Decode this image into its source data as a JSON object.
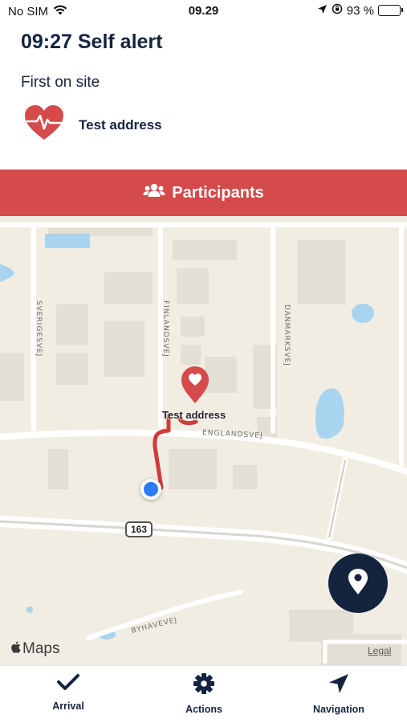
{
  "status_bar": {
    "carrier": "No SIM",
    "time": "09.29",
    "battery": "93 %"
  },
  "alert": {
    "title": "09:27 Self alert",
    "subtitle": "First on site",
    "address": "Test address"
  },
  "participants_button": {
    "label": "Participants"
  },
  "map": {
    "pin_label": "Test address",
    "street_labels": {
      "sverigesvej": "SVERIGESVEJ",
      "finlandsvej": "FINLANDSVEJ",
      "danmarksvej": "DANMARKSVEJ",
      "englandsvej": "ENGLANDSVEJ",
      "byhavevej": "BYHAVEVEJ"
    },
    "road_number": "163",
    "attribution": "Maps",
    "legal": "Legal"
  },
  "tabs": [
    {
      "label": "Arrival",
      "icon": "checkmark-icon"
    },
    {
      "label": "Actions",
      "icon": "gear-icon"
    },
    {
      "label": "Navigation",
      "icon": "navigation-arrow-icon"
    }
  ],
  "colors": {
    "accent_red": "#d54a4a",
    "navy": "#14243f",
    "route": "#d23a3a",
    "user_location": "#2d7cf6"
  }
}
